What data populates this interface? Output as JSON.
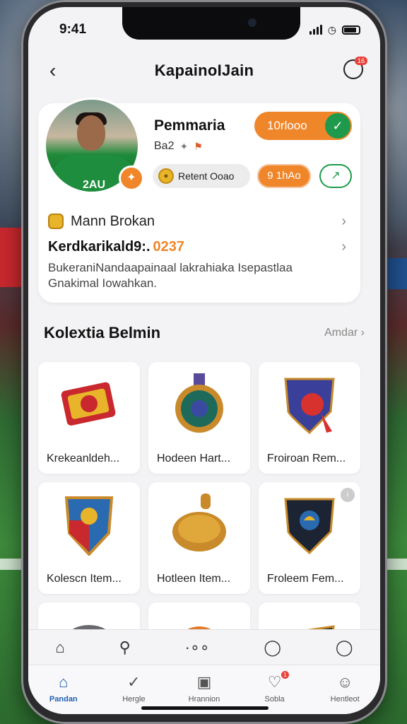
{
  "status": {
    "time": "9:41"
  },
  "header": {
    "title": "KapainoIJain",
    "notif_badge": "16"
  },
  "profile": {
    "name": "Pemmaria",
    "sub_code": "Ba2",
    "shirt_number": "2AU",
    "follow_label": "10rlooo",
    "chip_label": "Retent Ooao",
    "orange_pill": "9 1hAo",
    "row1_label": "Mann Brokan",
    "row2_a": "Kerdkarikald9:.",
    "row2_b": "0237",
    "description": "BukeraniNandaapainaal lakrahiaka Isepastlaa Gnakimal Iowahkan."
  },
  "collection": {
    "title": "Kolextia Belmin",
    "see_all": "Amdar",
    "items": [
      {
        "name": "Krekeanldeh...",
        "icon": "red-badge-icon",
        "color": "#c8282e"
      },
      {
        "name": "Hodeen Hart...",
        "icon": "blue-medal-icon",
        "color": "#1f4f8c"
      },
      {
        "name": "Froiroan Rem...",
        "icon": "shield-ball-icon",
        "color": "#3a3f9a"
      },
      {
        "name": "Kolescn Item...",
        "icon": "crest-icon",
        "color": "#2a6ab0"
      },
      {
        "name": "Hotleen Item...",
        "icon": "gold-coin-icon",
        "color": "#c88a2a"
      },
      {
        "name": "Froleem Fem...",
        "icon": "dark-shield-icon",
        "color": "#1c2433"
      }
    ],
    "partial_icons": [
      "helmet-icon",
      "orange-ball-icon",
      "green-shield-icon"
    ]
  },
  "tabbar": {
    "tabs": [
      {
        "label": "Pandan",
        "icon": "home-icon"
      },
      {
        "label": "Hergle",
        "icon": "check-circle-icon"
      },
      {
        "label": "Hrannion",
        "icon": "card-icon"
      },
      {
        "label": "Sobla",
        "icon": "heart-icon"
      },
      {
        "label": "Hentleot",
        "icon": "person-icon"
      }
    ]
  },
  "colors": {
    "accent": "#f0862a",
    "success": "#1f9a4c",
    "active_tab": "#1f5fb0"
  }
}
